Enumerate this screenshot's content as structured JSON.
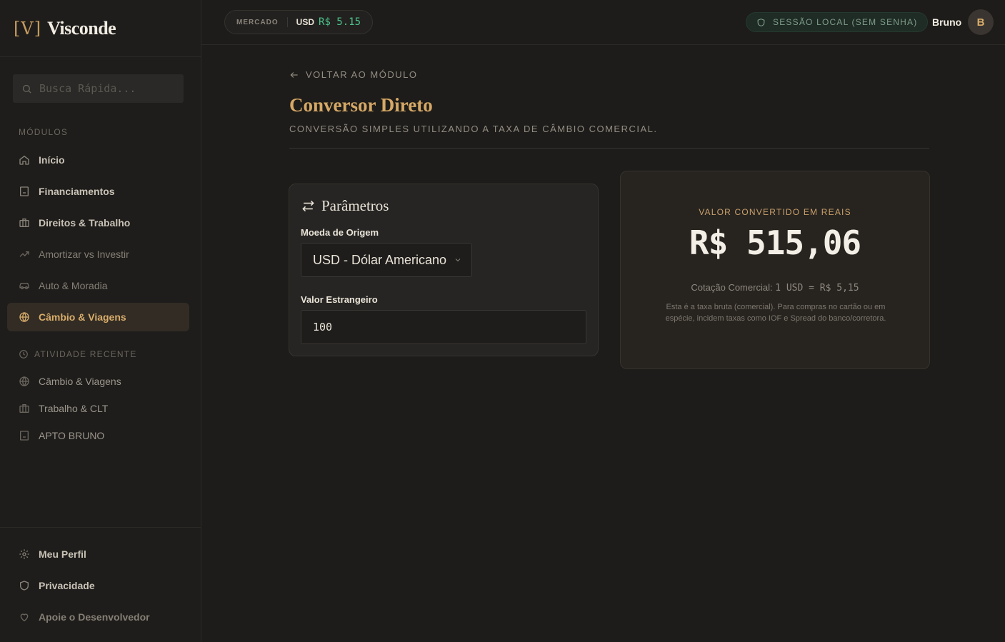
{
  "brand": {
    "mark": "[V]",
    "name": "Visconde"
  },
  "search": {
    "placeholder": "Busca Rápida..."
  },
  "sidebar": {
    "modules_label": "MÓDULOS",
    "items": [
      {
        "label": "Início",
        "icon": "home-icon"
      },
      {
        "label": "Financiamentos",
        "icon": "building-icon"
      },
      {
        "label": "Direitos & Trabalho",
        "icon": "briefcase-icon"
      },
      {
        "label": "Amortizar vs Investir",
        "icon": "trending-up-icon"
      },
      {
        "label": "Auto & Moradia",
        "icon": "car-icon"
      },
      {
        "label": "Câmbio & Viagens",
        "icon": "globe-icon",
        "active": true
      }
    ],
    "recent_label": "ATIVIDADE RECENTE",
    "recent": [
      {
        "label": "Câmbio & Viagens",
        "icon": "globe-icon"
      },
      {
        "label": "Trabalho & CLT",
        "icon": "briefcase-icon"
      },
      {
        "label": "APTO BRUNO",
        "icon": "building-icon"
      }
    ],
    "footer": [
      {
        "label": "Meu Perfil",
        "icon": "gear-icon"
      },
      {
        "label": "Privacidade",
        "icon": "shield-icon"
      },
      {
        "label": "Apoie o Desenvolvedor",
        "icon": "heart-icon"
      }
    ]
  },
  "topbar": {
    "market_label": "MERCADO",
    "currency": "USD",
    "rate": "R$ 5.15",
    "session": "SESSÃO LOCAL (SEM SENHA)",
    "user_name": "Bruno",
    "avatar_initial": "B"
  },
  "page": {
    "back_label": "VOLTAR AO MÓDULO",
    "title": "Conversor Direto",
    "subtitle": "CONVERSÃO SIMPLES UTILIZANDO A TAXA DE CÂMBIO COMERCIAL."
  },
  "params": {
    "title": "Parâmetros",
    "origin_label": "Moeda de Origem",
    "origin_value": "USD - Dólar Americano",
    "amount_label": "Valor Estrangeiro",
    "amount_value": "100"
  },
  "result": {
    "label": "VALOR CONVERTIDO EM REAIS",
    "value": "R$ 515,06",
    "rate_prefix": "Cotação Comercial:",
    "rate_value": "1 USD = R$ 5,15",
    "note": "Esta é a taxa bruta (comercial). Para compras no cartão ou em espécie, incidem taxas como IOF e Spread do banco/corretora."
  },
  "colors": {
    "accent": "#d6a866",
    "active_bg": "#322c24",
    "positive": "#4cc38a"
  }
}
